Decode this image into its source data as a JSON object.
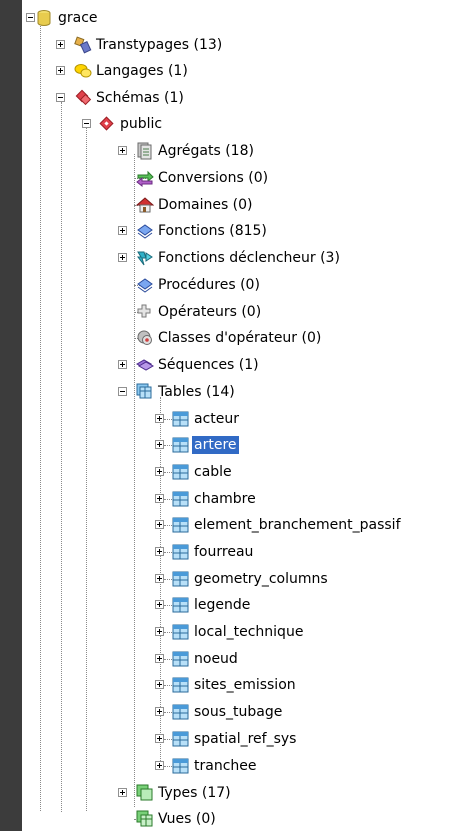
{
  "tree": {
    "root": {
      "label": "grace",
      "icon": "database-icon"
    },
    "items": [
      {
        "label": "Transtypages (13)",
        "icon": "cast-icon"
      },
      {
        "label": "Langages (1)",
        "icon": "language-icon"
      },
      {
        "label": "Schémas (1)",
        "icon": "schemas-icon"
      },
      {
        "label": "public",
        "icon": "schema-icon"
      },
      {
        "label": "Agrégats (18)",
        "icon": "aggregate-icon"
      },
      {
        "label": "Conversions (0)",
        "icon": "conversion-icon"
      },
      {
        "label": "Domaines (0)",
        "icon": "domain-icon"
      },
      {
        "label": "Fonctions (815)",
        "icon": "function-icon"
      },
      {
        "label": "Fonctions déclencheur (3)",
        "icon": "trigger-function-icon"
      },
      {
        "label": "Procédures (0)",
        "icon": "procedure-icon"
      },
      {
        "label": "Opérateurs (0)",
        "icon": "operator-icon"
      },
      {
        "label": "Classes d'opérateur (0)",
        "icon": "operator-class-icon"
      },
      {
        "label": "Séquences (1)",
        "icon": "sequence-icon"
      },
      {
        "label": "Tables (14)",
        "icon": "tables-icon"
      },
      {
        "label": "Types (17)",
        "icon": "types-icon"
      },
      {
        "label": "Vues (0)",
        "icon": "views-icon"
      }
    ],
    "tables": [
      "acteur",
      "artere",
      "cable",
      "chambre",
      "element_branchement_passif",
      "fourreau",
      "geometry_columns",
      "legende",
      "local_technique",
      "noeud",
      "sites_emission",
      "sous_tubage",
      "spatial_ref_sys",
      "tranchee"
    ],
    "selected": "artere",
    "colors": {
      "selection": "#316ac5",
      "background": "#ffffff",
      "frame": "#3c3c3c"
    }
  }
}
